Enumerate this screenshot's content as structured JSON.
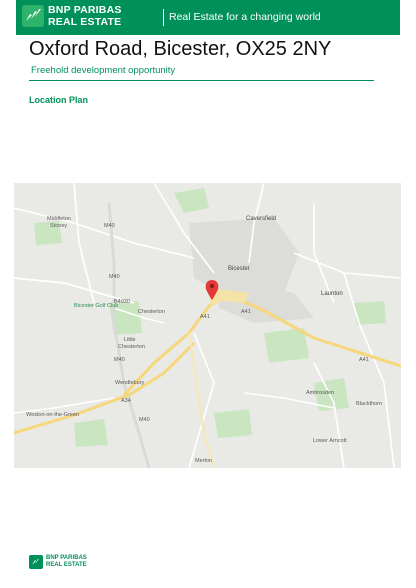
{
  "header": {
    "brand_line1": "BNP PARIBAS",
    "brand_line2": "REAL ESTATE",
    "tagline": "Real Estate for a changing world",
    "color": "#00915a",
    "logo_icon": "bnp-stars-logo-icon"
  },
  "title": "Oxford Road, Bicester, OX25 2NY",
  "subtitle": "Freehold development opportunity",
  "section_title": "Location Plan",
  "map": {
    "places": {
      "caversfield": "Caversfield",
      "middleton": "Middleton",
      "stoney": "Stoney",
      "bicester": "Bicester",
      "launton": "Launton",
      "golf": "Bicester Golf Club",
      "chesterton": "Chesterton",
      "little": "Little",
      "chesterton2": "Chesterton",
      "wendlebury": "Wendlebury",
      "ambrosden": "Ambrosden",
      "blackthorn": "Blackthorn",
      "weston": "Weston-on-the-Green",
      "lower_arncott": "Lower Arncott",
      "merton": "Merton"
    },
    "roads": {
      "a41_a": "A41",
      "a41_b": "A41",
      "a41_c": "A41",
      "a34": "A34",
      "m40_a": "M40",
      "m40_b": "M40",
      "m40_c": "M40",
      "m40_d": "M40",
      "b4030": "B4030"
    },
    "pin_icon": "location-pin-icon"
  },
  "footer": {
    "brand_line1": "BNP PARIBAS",
    "brand_line2": "REAL ESTATE"
  }
}
